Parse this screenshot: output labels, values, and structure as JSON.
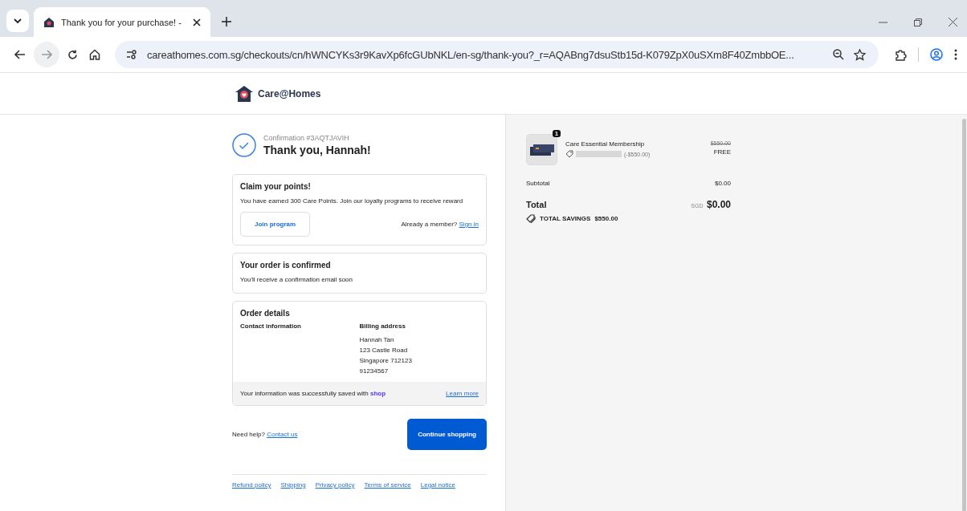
{
  "browser": {
    "tab_title": "Thank you for your purchase! - ",
    "url": "careathomes.com.sg/checkouts/cn/hWNCYKs3r9KavXp6fcGUbNKL/en-sg/thank-you?_r=AQABng7dsuStb15d-K079ZpX0uSXm8F40ZmbbOE..."
  },
  "header": {
    "brand": "Care@Homes"
  },
  "confirmation": {
    "number": "Confirmation #3AQTJAVIH",
    "title": "Thank you, Hannah!"
  },
  "points": {
    "title": "Claim your points!",
    "text": "You have earned 300 Care Points. Join our loyalty programs to receive reward",
    "join": "Join program",
    "member": "Already a member?",
    "sign_in": "Sign in"
  },
  "confirmed": {
    "title": "Your order is confirmed",
    "text": "You'll receive a confirmation email soon"
  },
  "details": {
    "title": "Order details",
    "contact_label": "Contact information",
    "billing_label": "Billing address",
    "billing_lines": [
      "Hannah Tan",
      "123 Castle Road",
      "Singapore 712123",
      "91234567"
    ],
    "saved_text": "Your information was successfully saved with",
    "saved_brand": "shop",
    "learn_more": "Learn more"
  },
  "help": {
    "text": "Need help?",
    "link": "Contact us",
    "continue": "Continue shopping"
  },
  "footer_links": [
    "Refund policy",
    "Shipping",
    "Privacy policy",
    "Terms of service",
    "Legal notice"
  ],
  "summary": {
    "item": {
      "name": "Care Essential Membership",
      "quantity": "1",
      "discount": "(-$550.00)",
      "old_price": "$550.00",
      "price": "FREE"
    },
    "subtotal_label": "Subtotal",
    "subtotal": "$0.00",
    "total_label": "Total",
    "currency": "SGD",
    "total": "$0.00",
    "savings_label": "TOTAL SAVINGS",
    "savings": "$550.00"
  }
}
